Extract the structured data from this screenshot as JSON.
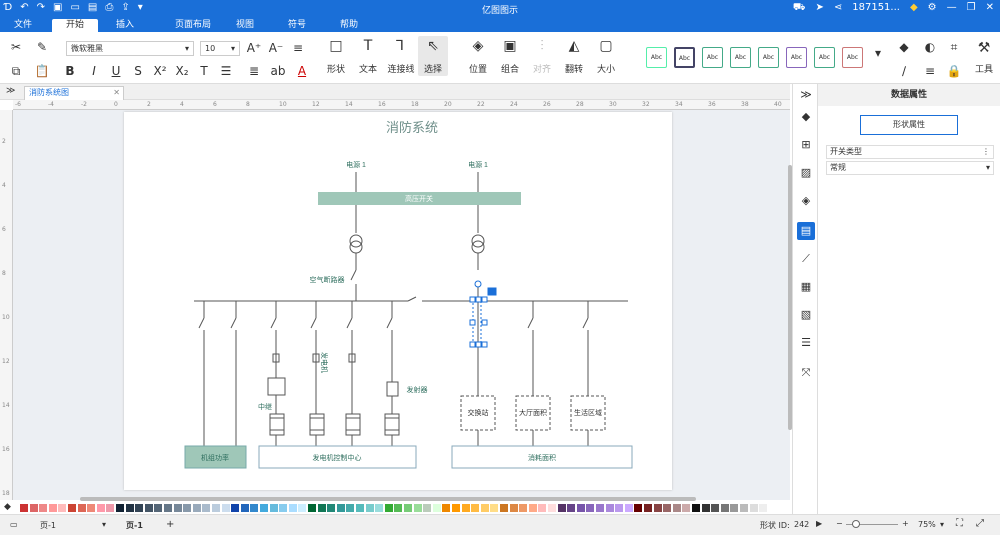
{
  "window": {
    "title": "亿图图示",
    "account": "187151..."
  },
  "ribbon_tabs": [
    "文件",
    "开始",
    "插入",
    "页面布局",
    "视图",
    "符号",
    "帮助"
  ],
  "ribbon": {
    "font_name": "微软雅黑",
    "font_size": "10",
    "groups": [
      "形状",
      "文本",
      "连接线",
      "选择",
      "位置",
      "组合",
      "对齐",
      "翻转",
      "大小"
    ],
    "style_label": "Abc",
    "tools_label": "工具",
    "style_colors": [
      "#5ea",
      "#446",
      "#4a8",
      "#4a8",
      "#4a8",
      "#86b",
      "#4a8",
      "#c77"
    ]
  },
  "doc_tab": "消防系统图",
  "rulers": {
    "h": [
      "-6",
      "-4",
      "-2",
      "0",
      "2",
      "4",
      "6",
      "8",
      "10",
      "12",
      "14",
      "16",
      "18",
      "20",
      "22",
      "24",
      "26",
      "28",
      "30",
      "32",
      "34",
      "36",
      "38",
      "40"
    ],
    "v": [
      "2",
      "4",
      "6",
      "8",
      "10",
      "12",
      "14",
      "16",
      "18"
    ]
  },
  "diagram": {
    "title": "消防系统",
    "power1": "电源 1",
    "power2": "电源 1",
    "high_voltage_switch": "高压开关",
    "air_breaker": "空气断路器",
    "generator": "发电机",
    "relay": "中继",
    "transmitter": "发射器",
    "exchange": "交换站",
    "lobby": "大厅面积",
    "living": "生活区域",
    "unit_power": "机组功率",
    "gen_control": "发电机控制中心",
    "consumption": "消耗面积"
  },
  "panel": {
    "title": "数据属性",
    "shape_attr_button": "形状属性",
    "field_label": "开关类型",
    "field_value": "常规"
  },
  "palette": [
    "#c33",
    "#d66",
    "#e88",
    "#f99",
    "#fbb",
    "#c43",
    "#d65",
    "#e87",
    "#f9a",
    "#e9a",
    "#123",
    "#234",
    "#345",
    "#456",
    "#567",
    "#678",
    "#789",
    "#89a",
    "#9ab",
    "#abc",
    "#bcd",
    "#cde",
    "#14a",
    "#26b",
    "#38c",
    "#4ad",
    "#6bd",
    "#8ce",
    "#adf",
    "#cef",
    "#063",
    "#175",
    "#287",
    "#399",
    "#4aa",
    "#5bb",
    "#7cc",
    "#9dd",
    "#3a3",
    "#5b5",
    "#7c7",
    "#9d9",
    "#bcb",
    "#dfd",
    "#e80",
    "#f90",
    "#fa2",
    "#fb4",
    "#fc6",
    "#fd8",
    "#c72",
    "#d84",
    "#e96",
    "#fa8",
    "#fbb",
    "#fdd",
    "#536",
    "#648",
    "#75a",
    "#86b",
    "#97c",
    "#a8d",
    "#b9e",
    "#caf",
    "#600",
    "#722",
    "#844",
    "#966",
    "#a88",
    "#caa",
    "#111",
    "#333",
    "#555",
    "#777",
    "#999",
    "#bbb",
    "#ddd",
    "#eee"
  ],
  "status": {
    "page_select": "页-1",
    "page_tab": "页-1",
    "add": "+",
    "shape_id_label": "形状 ID:",
    "shape_id": "242",
    "zoom": "75%"
  }
}
